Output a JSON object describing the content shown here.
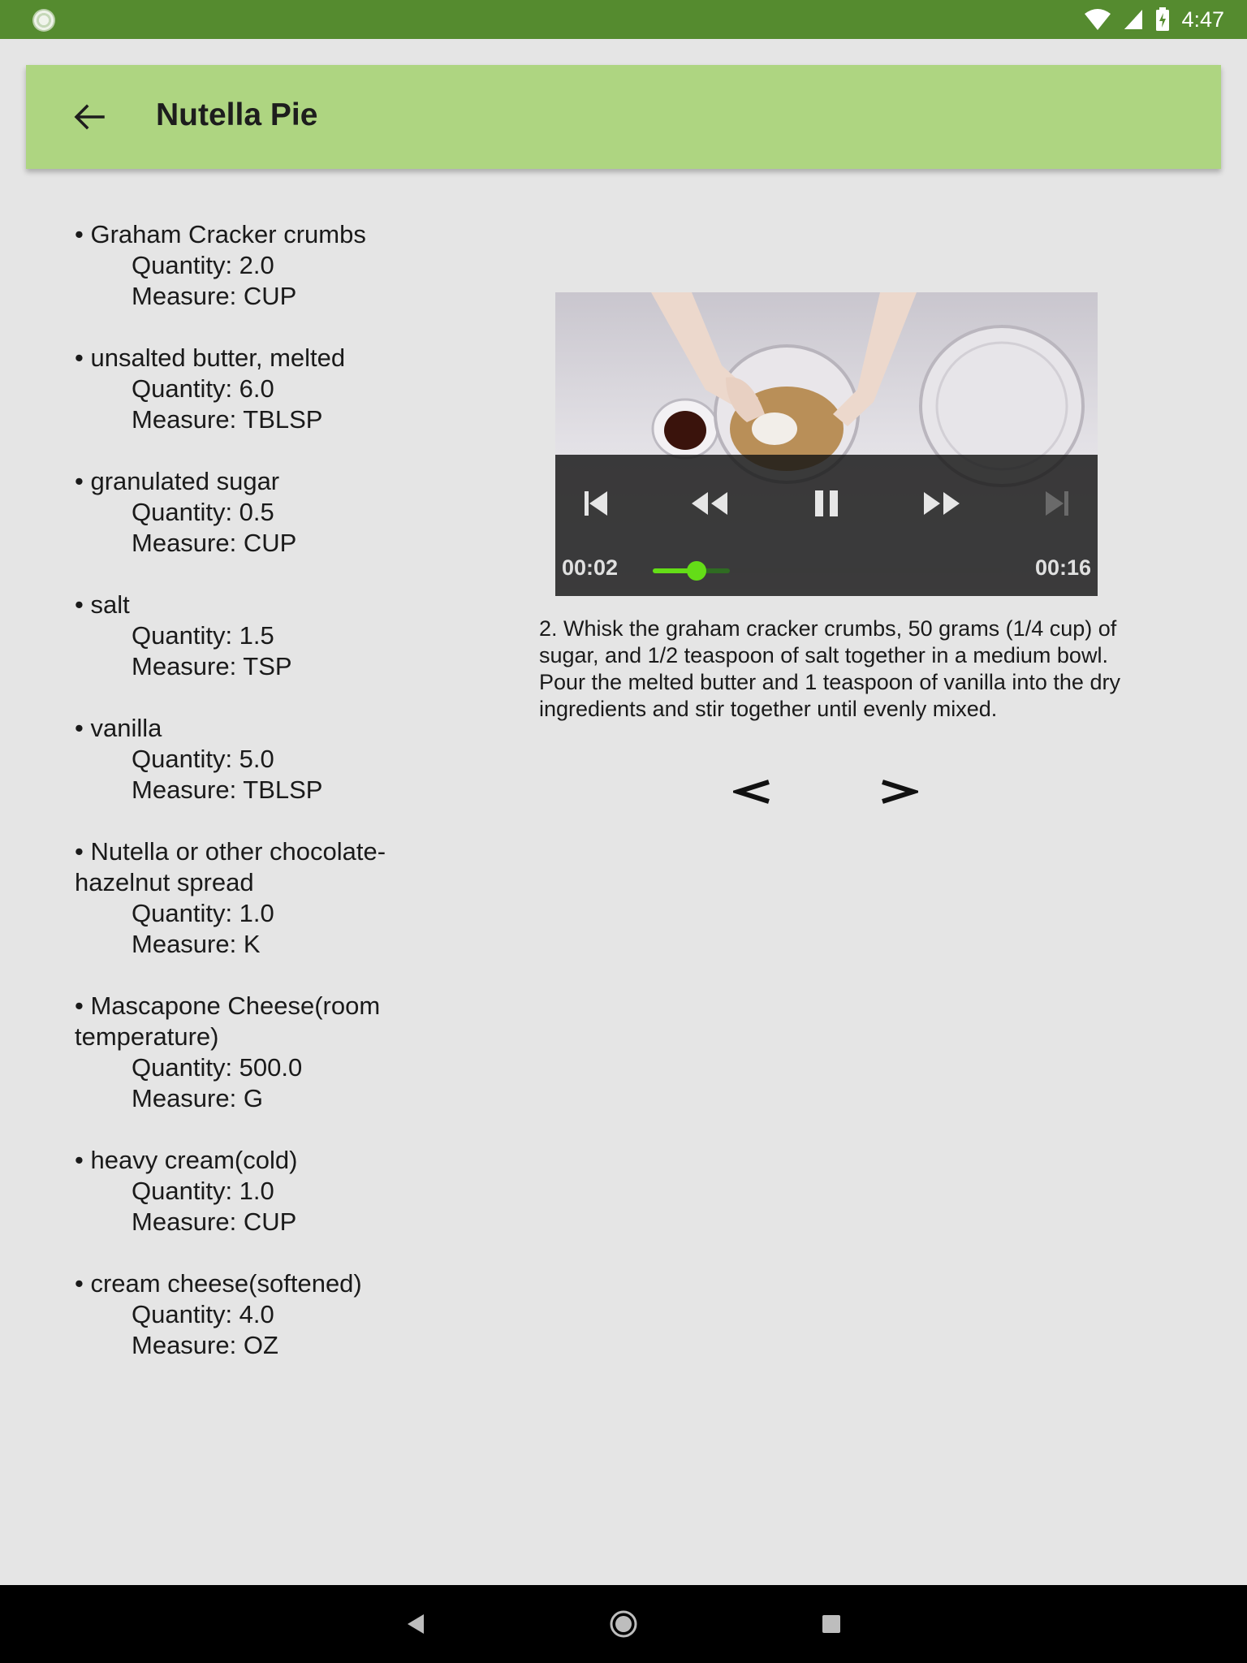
{
  "status_bar": {
    "time": "4:47",
    "icons": [
      "notification-icon",
      "wifi-icon",
      "cell-signal-icon",
      "battery-charging-icon"
    ]
  },
  "app_bar": {
    "title": "Nutella Pie",
    "back_icon": "arrow-back-icon",
    "background_color": "#aed581"
  },
  "ingredients": [
    {
      "name": "• Graham Cracker crumbs",
      "quantity": "Quantity: 2.0",
      "measure": "Measure: CUP"
    },
    {
      "name": "• unsalted butter, melted",
      "quantity": "Quantity: 6.0",
      "measure": "Measure: TBLSP"
    },
    {
      "name": "• granulated sugar",
      "quantity": "Quantity: 0.5",
      "measure": "Measure: CUP"
    },
    {
      "name": "• salt",
      "quantity": "Quantity: 1.5",
      "measure": "Measure: TSP"
    },
    {
      "name": "• vanilla",
      "quantity": "Quantity: 5.0",
      "measure": "Measure: TBLSP"
    },
    {
      "name": "• Nutella or other chocolate-hazelnut spread",
      "quantity": "Quantity: 1.0",
      "measure": "Measure: K"
    },
    {
      "name": "• Mascapone Cheese(room temperature)",
      "quantity": "Quantity: 500.0",
      "measure": "Measure: G"
    },
    {
      "name": "• heavy cream(cold)",
      "quantity": "Quantity: 1.0",
      "measure": "Measure: CUP"
    },
    {
      "name": "• cream cheese(softened)",
      "quantity": "Quantity: 4.0",
      "measure": "Measure: OZ"
    }
  ],
  "player": {
    "position": "00:02",
    "duration": "00:16",
    "played_fraction": 0.125,
    "buffered_fraction": 0.22,
    "accent_color": "#64dd17",
    "controls": [
      "skip-previous-icon",
      "rewind-icon",
      "pause-icon",
      "fast-forward-icon",
      "skip-next-icon"
    ]
  },
  "step": {
    "description": "2. Whisk the graham cracker crumbs, 50 grams (1/4 cup) of sugar, and 1/2 teaspoon of salt together in a medium bowl. Pour the melted butter and 1 teaspoon of vanilla into the dry ingredients and stir together until evenly mixed."
  },
  "step_nav": {
    "prev": "<",
    "next": ">"
  },
  "system_nav": [
    "back-triangle-icon",
    "home-circle-icon",
    "recents-square-icon"
  ]
}
